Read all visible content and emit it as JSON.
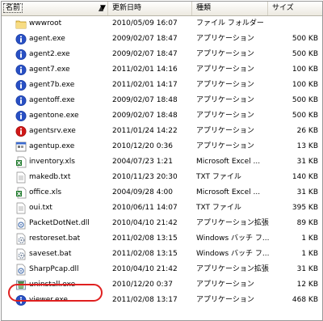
{
  "columns": {
    "name": "名前",
    "date": "更新日時",
    "type": "種類",
    "size": "サイズ"
  },
  "files": [
    {
      "name": "wwwroot",
      "date": "2010/05/09 16:07",
      "type": "ファイル フォルダー",
      "size": "",
      "icon": "folder-icon"
    },
    {
      "name": "agent.exe",
      "date": "2009/02/07 18:47",
      "type": "アプリケーション",
      "size": "500 KB",
      "icon": "info-app-icon"
    },
    {
      "name": "agent2.exe",
      "date": "2009/02/07 18:47",
      "type": "アプリケーション",
      "size": "500 KB",
      "icon": "info-app-icon"
    },
    {
      "name": "agent7.exe",
      "date": "2011/02/01 14:16",
      "type": "アプリケーション",
      "size": "100 KB",
      "icon": "info-app-icon"
    },
    {
      "name": "agent7b.exe",
      "date": "2011/02/01 14:17",
      "type": "アプリケーション",
      "size": "100 KB",
      "icon": "info-app-icon"
    },
    {
      "name": "agentoff.exe",
      "date": "2009/02/07 18:48",
      "type": "アプリケーション",
      "size": "500 KB",
      "icon": "info-app-icon"
    },
    {
      "name": "agentone.exe",
      "date": "2009/02/07 18:48",
      "type": "アプリケーション",
      "size": "500 KB",
      "icon": "info-app-icon"
    },
    {
      "name": "agentsrv.exe",
      "date": "2011/01/24 14:22",
      "type": "アプリケーション",
      "size": "26 KB",
      "icon": "red-info-app-icon"
    },
    {
      "name": "agentup.exe",
      "date": "2010/12/20 0:36",
      "type": "アプリケーション",
      "size": "13 KB",
      "icon": "generic-app-icon"
    },
    {
      "name": "inventory.xls",
      "date": "2004/07/23 1:21",
      "type": "Microsoft Excel ...",
      "size": "31 KB",
      "icon": "excel-icon"
    },
    {
      "name": "makedb.txt",
      "date": "2010/11/23 20:30",
      "type": "TXT ファイル",
      "size": "140 KB",
      "icon": "text-file-icon"
    },
    {
      "name": "office.xls",
      "date": "2004/09/28 4:00",
      "type": "Microsoft Excel ...",
      "size": "31 KB",
      "icon": "excel-icon"
    },
    {
      "name": "oui.txt",
      "date": "2010/06/11 14:07",
      "type": "TXT ファイル",
      "size": "395 KB",
      "icon": "text-file-icon"
    },
    {
      "name": "PacketDotNet.dll",
      "date": "2010/04/10 21:42",
      "type": "アプリケーション拡張",
      "size": "89 KB",
      "icon": "dll-icon"
    },
    {
      "name": "restoreset.bat",
      "date": "2011/02/08 13:15",
      "type": "Windows バッチ フ...",
      "size": "1 KB",
      "icon": "batch-icon"
    },
    {
      "name": "saveset.bat",
      "date": "2011/02/08 13:15",
      "type": "Windows バッチ フ...",
      "size": "1 KB",
      "icon": "batch-icon"
    },
    {
      "name": "SharpPcap.dll",
      "date": "2010/04/10 21:42",
      "type": "アプリケーション拡張",
      "size": "31 KB",
      "icon": "dll-icon"
    },
    {
      "name": "uninstall.exe",
      "date": "2010/12/20 0:37",
      "type": "アプリケーション",
      "size": "12 KB",
      "icon": "uninstall-icon"
    },
    {
      "name": "viewer.exe",
      "date": "2011/02/08 13:17",
      "type": "アプリケーション",
      "size": "468 KB",
      "icon": "info-app-icon"
    }
  ],
  "highlighted_file": "uninstall.exe",
  "colors": {
    "info_blue": "#1a3fa8",
    "info_red": "#d01818",
    "folder_yellow": "#f4d26a",
    "excel_green": "#1f7a2c",
    "highlight_ring": "#e02020"
  }
}
